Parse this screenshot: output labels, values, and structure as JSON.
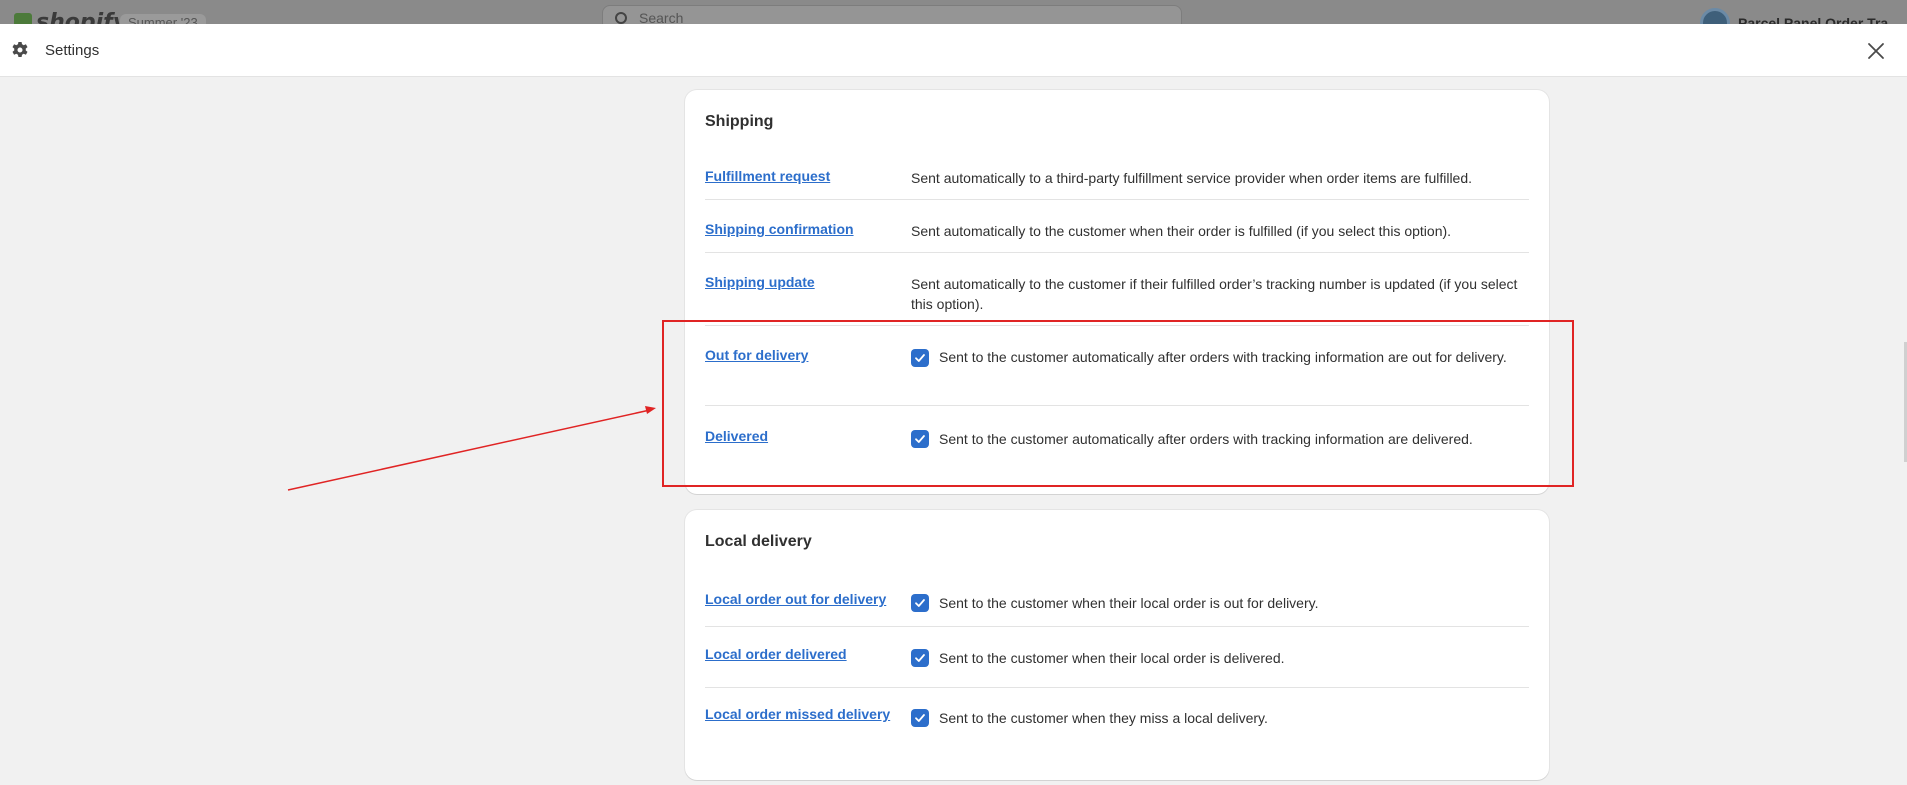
{
  "topbar": {
    "logo_text": "shopify",
    "badge": "Summer '23",
    "search_placeholder": "Search",
    "store_name": "Parcel Panel Order Tra"
  },
  "modal": {
    "title": "Settings",
    "settings_icon": "gear-icon",
    "close_icon": "close-icon"
  },
  "shipping": {
    "title": "Shipping",
    "items": [
      {
        "label": "Fulfillment request",
        "description": "Sent automatically to a third-party fulfillment service provider when order items are fulfilled.",
        "checked": null
      },
      {
        "label": "Shipping confirmation",
        "description": "Sent automatically to the customer when their order is fulfilled (if you select this option).",
        "checked": null
      },
      {
        "label": "Shipping update",
        "description": "Sent automatically to the customer if their fulfilled order’s tracking number is updated (if you select this option).",
        "checked": null
      },
      {
        "label": "Out for delivery",
        "description": "Sent to the customer automatically after orders with tracking information are out for delivery.",
        "checked": true
      },
      {
        "label": "Delivered",
        "description": "Sent to the customer automatically after orders with tracking information are delivered.",
        "checked": true
      }
    ]
  },
  "local_delivery": {
    "title": "Local delivery",
    "items": [
      {
        "label": "Local order out for delivery",
        "description": "Sent to the customer when their local order is out for delivery.",
        "checked": true
      },
      {
        "label": "Local order delivered",
        "description": "Sent to the customer when their local order is delivered.",
        "checked": true
      },
      {
        "label": "Local order missed delivery",
        "description": "Sent to the customer when they miss a local delivery.",
        "checked": true
      }
    ]
  },
  "colors": {
    "link": "#2c6ecb",
    "checkbox": "#2c6ecb",
    "annotation": "#e02424"
  }
}
